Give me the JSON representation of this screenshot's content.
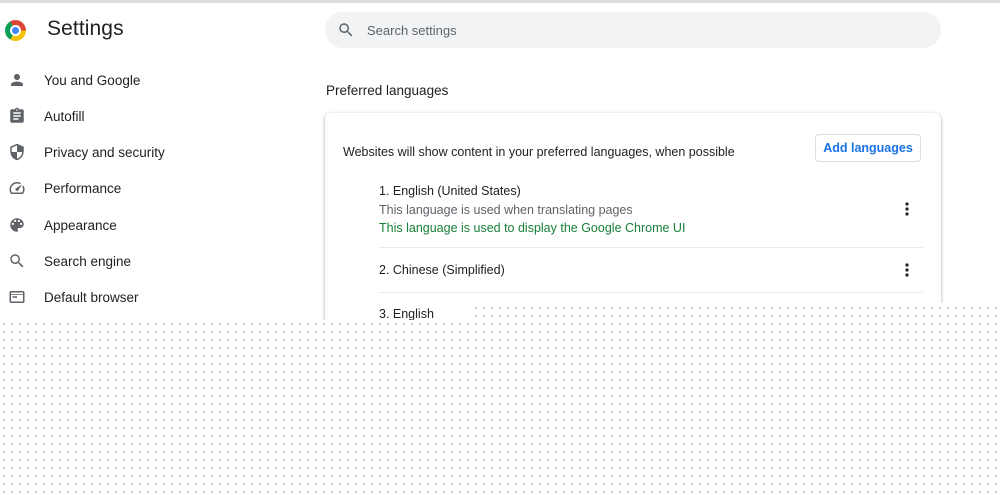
{
  "header": {
    "title": "Settings",
    "logo_icon": "chrome-logo-icon"
  },
  "search": {
    "placeholder": "Search settings",
    "value": "",
    "icon": "search-icon"
  },
  "sidebar": {
    "items": [
      {
        "label": "You and Google",
        "icon": "person-icon"
      },
      {
        "label": "Autofill",
        "icon": "clipboard-icon"
      },
      {
        "label": "Privacy and security",
        "icon": "shield-icon"
      },
      {
        "label": "Performance",
        "icon": "speedometer-icon"
      },
      {
        "label": "Appearance",
        "icon": "palette-icon"
      },
      {
        "label": "Search engine",
        "icon": "search-icon"
      },
      {
        "label": "Default browser",
        "icon": "browser-window-icon"
      }
    ]
  },
  "main": {
    "section_title": "Preferred languages",
    "card": {
      "description": "Websites will show content in your preferred languages, when possible",
      "add_button_label": "Add languages",
      "languages": [
        {
          "name": "1. English (United States)",
          "translate_note": "This language is used when translating pages",
          "ui_note": "This language is used to display the Google Chrome UI"
        },
        {
          "name": "2. Chinese (Simplified)"
        },
        {
          "name": "3. English"
        }
      ]
    }
  },
  "colors": {
    "accent_blue": "#1a73e8",
    "ui_note_green": "#188038",
    "icon_gray": "#5f6368",
    "text_primary": "#202124"
  }
}
